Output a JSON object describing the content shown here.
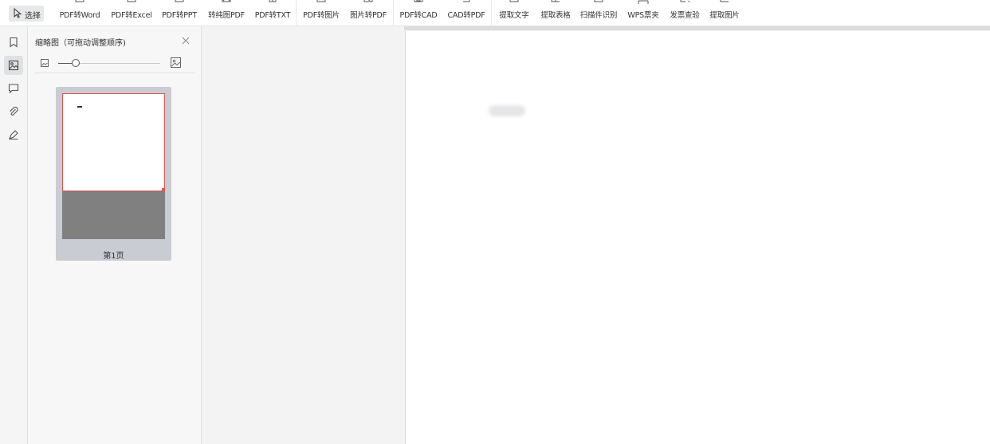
{
  "toolbar": {
    "select_label": "选择",
    "tools": [
      {
        "label": "PDF转Word",
        "icon": "pdf-to-word-icon"
      },
      {
        "label": "PDF转Excel",
        "icon": "pdf-to-excel-icon"
      },
      {
        "label": "PDF转PPT",
        "icon": "pdf-to-ppt-icon"
      },
      {
        "label": "转纯图PDF",
        "icon": "to-image-pdf-icon"
      },
      {
        "label": "PDF转TXT",
        "icon": "pdf-to-txt-icon"
      },
      {
        "label": "PDF转图片",
        "icon": "pdf-to-image-icon"
      },
      {
        "label": "图片转PDF",
        "icon": "image-to-pdf-icon"
      },
      {
        "label": "PDF转CAD",
        "icon": "pdf-to-cad-icon"
      },
      {
        "label": "CAD转PDF",
        "icon": "cad-to-pdf-icon"
      },
      {
        "label": "提取文字",
        "icon": "extract-text-icon"
      },
      {
        "label": "提取表格",
        "icon": "extract-table-icon"
      },
      {
        "label": "扫描件识别",
        "icon": "scan-recognize-icon"
      },
      {
        "label": "WPS票夹",
        "icon": "ticket-folder-icon"
      },
      {
        "label": "发票查验",
        "icon": "invoice-check-icon"
      },
      {
        "label": "提取图片",
        "icon": "extract-image-icon"
      }
    ]
  },
  "rail": {
    "items": [
      {
        "icon": "bookmark-icon"
      },
      {
        "icon": "thumbnail-icon"
      },
      {
        "icon": "comment-icon"
      },
      {
        "icon": "attachment-icon"
      },
      {
        "icon": "signature-icon"
      }
    ]
  },
  "panel": {
    "title": "缩略图（可拖动调整顺序)",
    "close_icon": "close-icon",
    "page_label": "第1页"
  }
}
